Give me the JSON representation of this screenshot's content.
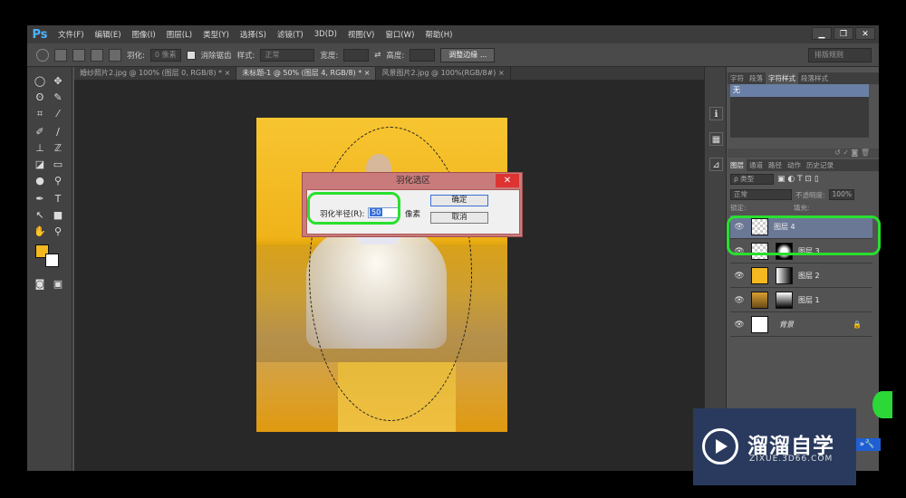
{
  "app": {
    "logo": "Ps"
  },
  "menu": [
    "文件(F)",
    "编辑(E)",
    "图像(I)",
    "图层(L)",
    "类型(Y)",
    "选择(S)",
    "滤镜(T)",
    "3D(D)",
    "视图(V)",
    "窗口(W)",
    "帮助(H)"
  ],
  "window_buttons": [
    "▁",
    "❐",
    "✕"
  ],
  "options": {
    "feather_label": "羽化:",
    "feather_value": "0 像素",
    "antialias_label": "消除锯齿",
    "style_label": "样式:",
    "style_value": "正常",
    "width_label": "宽度:",
    "height_label": "高度:",
    "refine_btn": "调整边缘 ...",
    "workspace": "排版规则"
  },
  "tabs": [
    "婚纱照片2.jpg @ 100% (图层 0, RGB/8) * ×",
    "未标题-1 @ 50% (图层 4, RGB/8) * ×",
    "风景图片2.jpg @ 100%(RGB/8#) ×"
  ],
  "dialog": {
    "title": "羽化选区",
    "close": "✕",
    "label": "羽化半径(R):",
    "value": "50",
    "unit": "像素",
    "ok": "确定",
    "cancel": "取消"
  },
  "char_panel": {
    "tabs": [
      "字符",
      "段落",
      "字符样式",
      "段落样式"
    ],
    "selected": "无"
  },
  "layers_panel": {
    "tabs": [
      "图层",
      "通道",
      "路径",
      "动作",
      "历史记录"
    ],
    "filter": "ρ 类型",
    "blend": "正常",
    "opacity_label": "不透明度:",
    "opacity": "100%",
    "lock_label": "锁定:",
    "fill_label": "填充:",
    "layers": [
      {
        "name": "图层 4",
        "selected": true
      },
      {
        "name": "图层 3",
        "selected": false
      },
      {
        "name": "图层 2",
        "selected": false
      },
      {
        "name": "图层 1",
        "selected": false
      },
      {
        "name": "背景",
        "selected": false
      }
    ]
  },
  "watermark": {
    "title": "溜溜自学",
    "sub": "ZIXUE.3D66.COM"
  },
  "colors": {
    "highlight": "#29e02f",
    "fg_color": "#f5b820",
    "bg_color": "#ffffff"
  }
}
